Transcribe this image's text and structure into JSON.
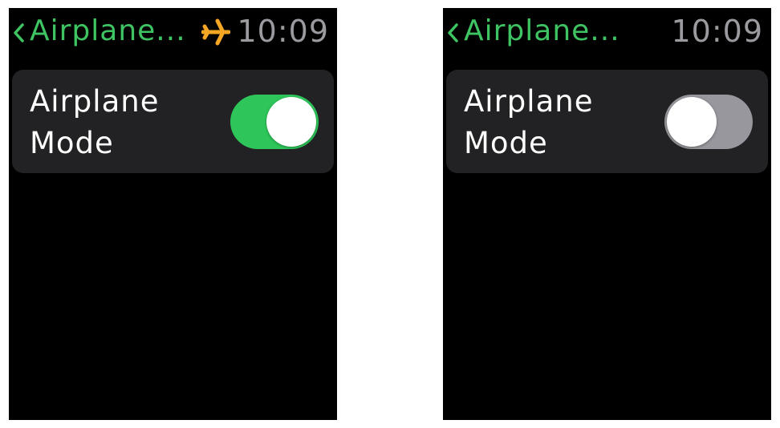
{
  "colors": {
    "accent": "#3ec462",
    "toggle_on": "#2ec65a",
    "toggle_off": "#98979d",
    "airplane_indicator": "#f5a623",
    "time": "#9a9a9f",
    "card": "#222224"
  },
  "screens": [
    {
      "nav": {
        "back_icon": "chevron-left-icon",
        "title": "Airplane...",
        "airplane_indicator_icon": "airplane-icon",
        "time": "10:09"
      },
      "setting": {
        "label": "Airplane Mode",
        "toggle_state": "on"
      }
    },
    {
      "nav": {
        "back_icon": "chevron-left-icon",
        "title": "Airplane...",
        "time": "10:09"
      },
      "setting": {
        "label": "Airplane Mode",
        "toggle_state": "off"
      }
    }
  ]
}
